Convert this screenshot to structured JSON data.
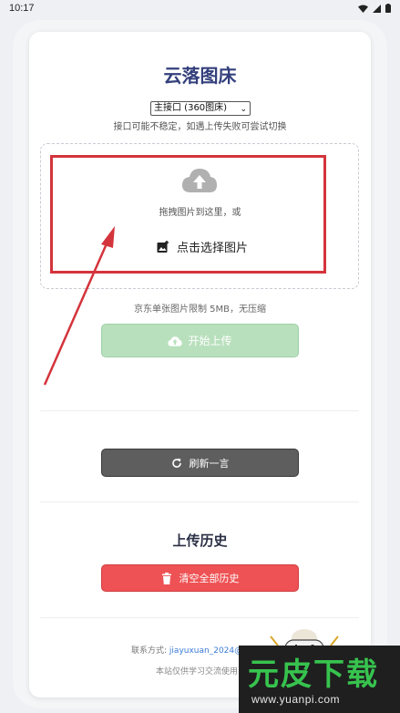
{
  "status": {
    "time": "10:17"
  },
  "title": "云落图床",
  "api_select": {
    "selected": "主接口 (360图床)"
  },
  "hint": "接口可能不稳定，如遇上传失败可尝试切换",
  "dropzone": {
    "drag_text": "拖拽图片到这里，或",
    "pick_text": "点击选择图片"
  },
  "limit_text": "京东单张图片限制 5MB，无压缩",
  "buttons": {
    "upload": "开始上传",
    "refresh": "刷新一言",
    "clear": "清空全部历史"
  },
  "history_title": "上传历史",
  "footer": {
    "contact_label": "联系方式:",
    "contact_email": "jiayuxuan_2024@qq.com",
    "note": "本站仅供学习交流使用"
  },
  "watermark": {
    "title": "元皮下载",
    "url": "www.yuanpi.com"
  },
  "colors": {
    "title": "#34407c",
    "upload": "#b9e0bd",
    "refresh": "#5e5e5e",
    "clear": "#ee5254",
    "highlight": "#d4343c"
  }
}
